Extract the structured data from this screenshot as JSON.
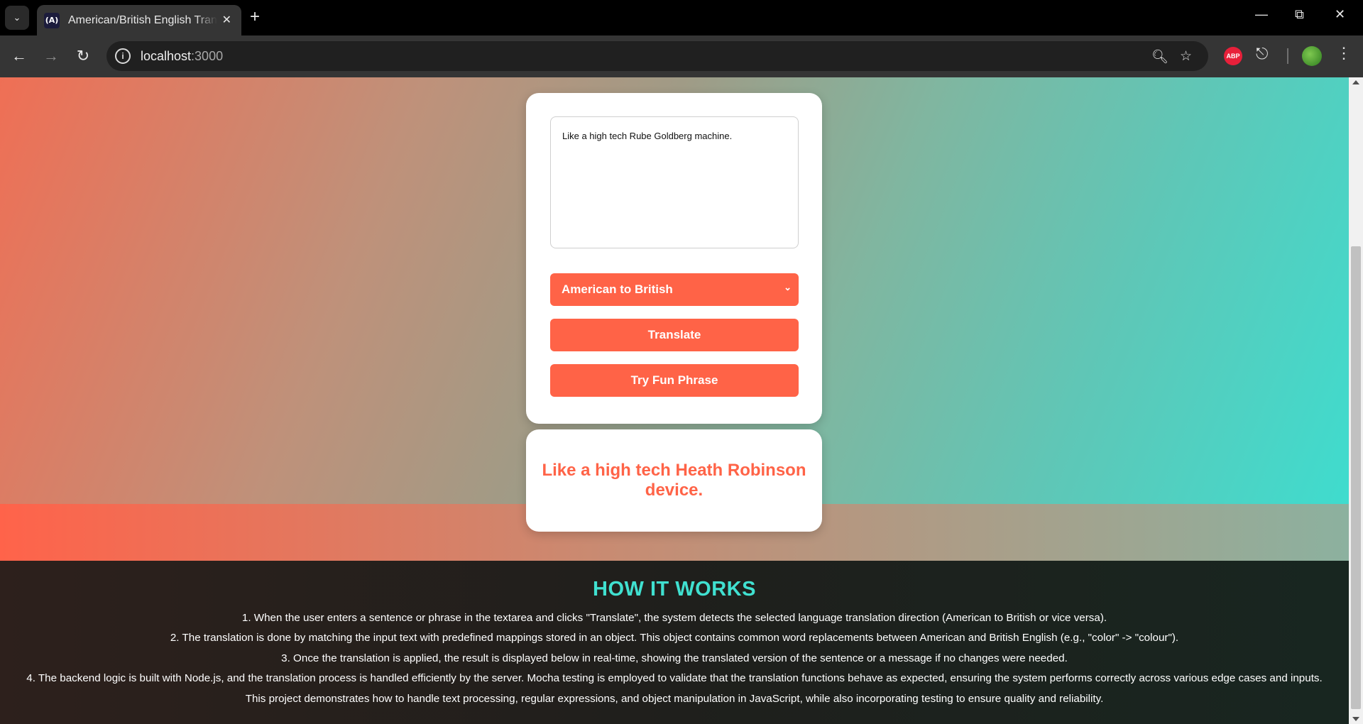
{
  "browser": {
    "tab_title": "American/British English Translator",
    "favicon_text": "(A)",
    "url_host": "localhost",
    "url_port": ":3000",
    "abp_label": "ABP"
  },
  "translator": {
    "input_text": "Like a high tech Rube Goldberg machine.",
    "direction_selected": "American to British",
    "translate_label": "Translate",
    "fun_phrase_label": "Try Fun Phrase",
    "result": "Like a high tech Heath Robinson device."
  },
  "how_it_works": {
    "title": "HOW IT WORKS",
    "lines": [
      "1. When the user enters a sentence or phrase in the textarea and clicks \"Translate\", the system detects the selected language translation direction (American to British or vice versa).",
      "2. The translation is done by matching the input text with predefined mappings stored in an object. This object contains common word replacements between American and British English (e.g., \"color\" -> \"colour\").",
      "3. Once the translation is applied, the result is displayed below in real-time, showing the translated version of the sentence or a message if no changes were needed.",
      "4. The backend logic is built with Node.js, and the translation process is handled efficiently by the server. Mocha testing is employed to validate that the translation functions behave as expected, ensuring the system performs correctly across various edge cases and inputs.",
      "This project demonstrates how to handle text processing, regular expressions, and object manipulation in JavaScript, while also incorporating testing to ensure quality and reliability."
    ]
  }
}
